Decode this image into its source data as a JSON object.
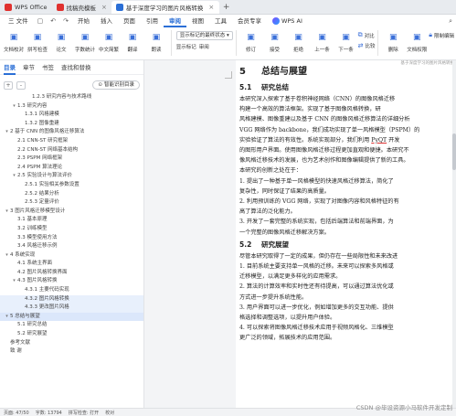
{
  "titlebar": {
    "tabs": [
      {
        "label": "WPS Office",
        "icon": "wps-logo-icon",
        "color": "#e0312f",
        "active": false
      },
      {
        "label": "找稿壳模板",
        "icon": "template-icon",
        "color": "#e0312f",
        "active": false
      },
      {
        "label": "基于深度学习的图片风格转换",
        "icon": "word-doc-icon",
        "color": "#2b6fd6",
        "active": true
      }
    ],
    "new_tab": "+"
  },
  "menubar": {
    "file": "三 文件",
    "items": [
      "开始",
      "插入",
      "页面",
      "引用",
      "审阅",
      "视图",
      "工具",
      "会员专享"
    ],
    "active": "审阅",
    "wps_ai": "WPS AI"
  },
  "ribbon": {
    "left_buttons": [
      {
        "label": "文档校对",
        "icon": "proofread-icon"
      },
      {
        "label": "拼写检查",
        "icon": "spellcheck-icon"
      },
      {
        "label": "论文",
        "icon": "paper-icon"
      },
      {
        "label": "字数统计",
        "icon": "wordcount-icon"
      },
      {
        "label": "中文简繁",
        "icon": "chinese-convert-icon"
      },
      {
        "label": "翻译",
        "icon": "translate-icon"
      },
      {
        "label": "朗读",
        "icon": "read-aloud-icon"
      }
    ],
    "display_select": "显示标记的最终状态",
    "display_options": [
      "显示标记",
      "审阅"
    ],
    "mid_buttons": [
      {
        "label": "修订",
        "icon": "track-changes-icon"
      },
      {
        "label": "接受",
        "icon": "accept-icon"
      },
      {
        "label": "拒绝",
        "icon": "reject-icon"
      },
      {
        "label": "上一条",
        "icon": "prev-icon"
      },
      {
        "label": "下一条",
        "icon": "next-icon"
      }
    ],
    "small_buttons": [
      "对比",
      "比较",
      "限制编辑"
    ],
    "right_buttons": [
      {
        "label": "删除",
        "icon": "delete-icon"
      },
      {
        "label": "文档权限",
        "icon": "permission-icon"
      }
    ]
  },
  "nav": {
    "tabs": [
      "目录",
      "章节",
      "书签",
      "查找和替换"
    ],
    "active_tab": "目录",
    "tool_expand": "+",
    "tool_collapse": "-",
    "smart_dir": "智能识别目录",
    "outline": [
      {
        "text": "1.2.3 研究内容与技术路线",
        "level": 3,
        "arrow": "",
        "state": ""
      },
      {
        "text": "1.3 研究内容",
        "level": 1,
        "arrow": "▾",
        "state": ""
      },
      {
        "text": "1.3.1 风格建模",
        "level": 2,
        "arrow": "",
        "state": ""
      },
      {
        "text": "1.3.2 图像重建",
        "level": 2,
        "arrow": "",
        "state": ""
      },
      {
        "text": "2 基于 CNN 的图像风格迁移算法",
        "level": 0,
        "arrow": "▾",
        "state": ""
      },
      {
        "text": "2.1 CNN-ST 研究框架",
        "level": 1,
        "arrow": "",
        "state": ""
      },
      {
        "text": "2.2 CNN-ST 网络基本结构",
        "level": 1,
        "arrow": "",
        "state": ""
      },
      {
        "text": "2.3 PSPM 网络框架",
        "level": 1,
        "arrow": "",
        "state": ""
      },
      {
        "text": "2.4 PSPM 算法理论",
        "level": 1,
        "arrow": "",
        "state": ""
      },
      {
        "text": "2.5 实验设计与算法评价",
        "level": 1,
        "arrow": "▾",
        "state": ""
      },
      {
        "text": "2.5.1 实验相关参数设置",
        "level": 2,
        "arrow": "",
        "state": ""
      },
      {
        "text": "2.5.2 结果分析",
        "level": 2,
        "arrow": "",
        "state": ""
      },
      {
        "text": "2.5.3 定量评价",
        "level": 2,
        "arrow": "",
        "state": ""
      },
      {
        "text": "3 图片风格迁移模型设计",
        "level": 0,
        "arrow": "▾",
        "state": ""
      },
      {
        "text": "3.1 基本原理",
        "level": 1,
        "arrow": "",
        "state": ""
      },
      {
        "text": "3.2 训练模型",
        "level": 1,
        "arrow": "",
        "state": ""
      },
      {
        "text": "3.3 模型使用方法",
        "level": 1,
        "arrow": "",
        "state": ""
      },
      {
        "text": "3.4 风格迁移示例",
        "level": 1,
        "arrow": "",
        "state": ""
      },
      {
        "text": "4 系统实现",
        "level": 0,
        "arrow": "▾",
        "state": ""
      },
      {
        "text": "4.1 系统主界面",
        "level": 1,
        "arrow": "",
        "state": ""
      },
      {
        "text": "4.2 图片风格转换界面",
        "level": 1,
        "arrow": "",
        "state": ""
      },
      {
        "text": "4.3 图片风格转换",
        "level": 1,
        "arrow": "▾",
        "state": ""
      },
      {
        "text": "4.3.1 主要代码实现",
        "level": 2,
        "arrow": "",
        "state": ""
      },
      {
        "text": "4.3.2 图片风格转换",
        "level": 2,
        "arrow": "",
        "state": "hl"
      },
      {
        "text": "4.3.3 更改图片风格",
        "level": 2,
        "arrow": "",
        "state": "hl"
      },
      {
        "text": "5 总结与展望",
        "level": 0,
        "arrow": "▾",
        "state": "sel"
      },
      {
        "text": "5.1 研究总结",
        "level": 1,
        "arrow": "",
        "state": ""
      },
      {
        "text": "5.2 研究展望",
        "level": 1,
        "arrow": "",
        "state": ""
      },
      {
        "text": "参考文献",
        "level": 0,
        "arrow": "",
        "state": ""
      },
      {
        "text": "致  谢",
        "level": 0,
        "arrow": "",
        "state": ""
      }
    ]
  },
  "doc": {
    "header_note": "基于深度学习的图片风格转换",
    "chapter_num": "5",
    "chapter_title": "总结与展望",
    "s1_num": "5.1",
    "s1_title": "研究总结",
    "s1_paras": [
      "本研究深入探索了基于卷积神经网络（CNN）的图像风格迁移",
      "构建一个高效的算法框架。实现了基于图像风格转换，研",
      "风格建模、图像重建以及基于 CNN 的图像风格迁移算法的详细分析",
      "VGG 网络作为 backbone，我们成功实现了单一风格模型（PSPM）的",
      "实验验证了算法的有效性。系统实现部分，我们利用 PyQT 开发",
      "的图形用户界面。使用图像风格迁移过程更加直观和便捷。本研究不",
      "像风格迁移技术的发展，也为艺术创作和图像编辑提供了新的工具。",
      "本研究的创新之处在于：",
      "1. 提出了一种基于单一风格模型的快速风格迁移算法，简化了",
      "复杂性，同时保证了结果的高质量。",
      "2. 利用预训练的 VGG 网络，实现了对图像内容和风格特征的有",
      "高了算法的泛化能力。",
      "3. 开发了一套完整的系统实现，包括后端算法和前端界面，为",
      "一个完整的图像风格迁移解决方案。"
    ],
    "pyqt": "PyQT",
    "s2_num": "5.2",
    "s2_title": "研究展望",
    "s2_paras": [
      "尽管本研究取得了一定的成果，但仍存在一些局限性和未来改进",
      "1. 目前系统主要支持单一风格的迁移。未来可以探索多风格或",
      "迁移模型，以满足更多样化的应用需求。",
      "2. 算法的计算效率和实时性还有待提高，可以通过算法优化或",
      "方式进一步提升系统性能。",
      "3. 用户界面可以进一步优化，例如增加更多的交互功能、提供",
      "格选择和调整选项，以提升用户体验。",
      "4. 可以探索将图像风格迁移技术应用于视频风格化、三维模型",
      "更广泛的领域，拓展技术的应用范围。"
    ]
  },
  "status": {
    "page": "页面: 47/50",
    "words": "字数: 13794",
    "spell": "拼写检查: 打开",
    "proof": "校对"
  },
  "watermark": "CSDN @毕设资源小马软件开发定制"
}
